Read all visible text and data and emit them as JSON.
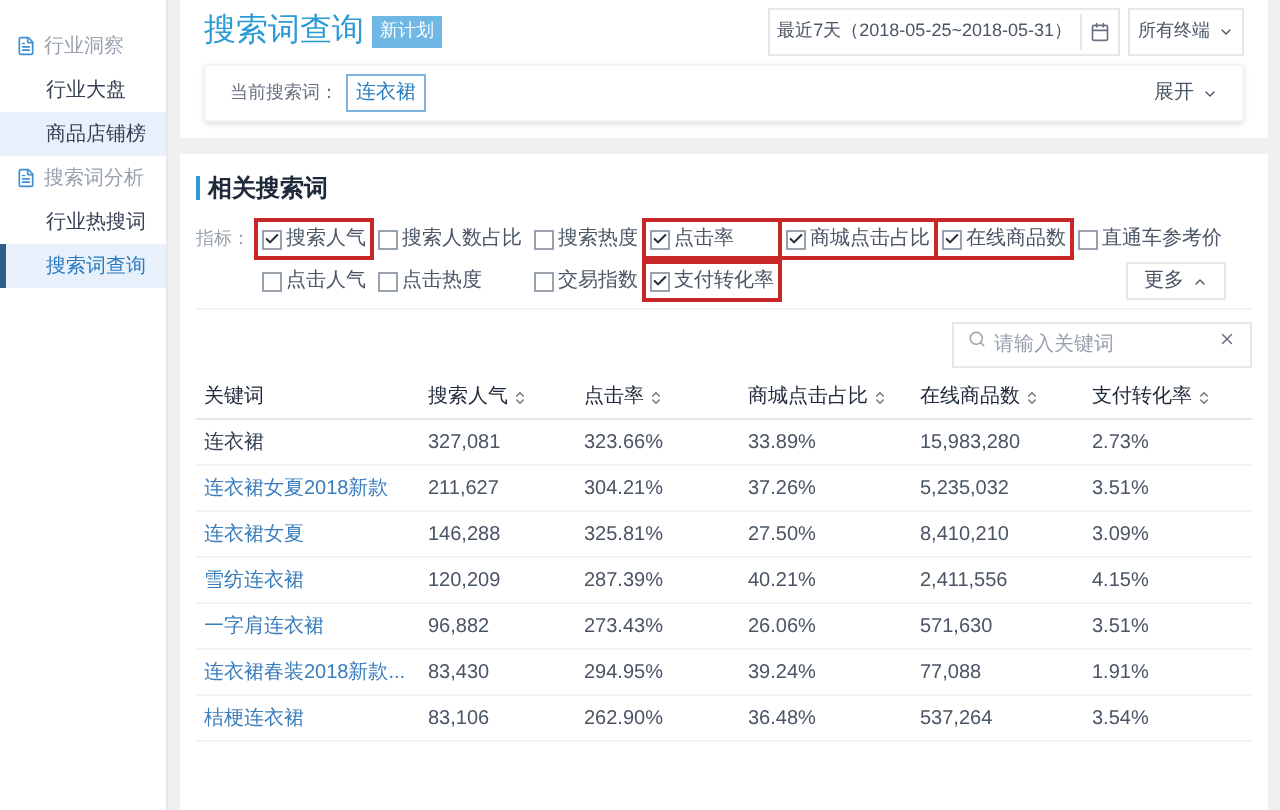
{
  "sidebar": {
    "sections": [
      {
        "title": "行业洞察",
        "children": [
          {
            "label": "行业大盘",
            "selected": false,
            "highlighted": false
          },
          {
            "label": "商品店铺榜",
            "selected": false,
            "highlighted": true
          }
        ]
      },
      {
        "title": "搜索词分析",
        "children": [
          {
            "label": "行业热搜词",
            "selected": false,
            "highlighted": false
          },
          {
            "label": "搜索词查询",
            "selected": true,
            "highlighted": true
          }
        ]
      }
    ]
  },
  "header": {
    "title": "搜索词查询",
    "badge": "新计划",
    "date_range": "最近7天（2018-05-25~2018-05-31）",
    "terminal": "所有终端",
    "current_label": "当前搜索词：",
    "current_word": "连衣裙",
    "expand": "展开"
  },
  "related": {
    "title": "相关搜索词",
    "metrics_label": "指标：",
    "more": "更多",
    "metric_rows": [
      {
        "metrics": [
          {
            "label": "搜索人气",
            "checked": true
          },
          {
            "label": "搜索人数占比",
            "checked": false
          },
          {
            "label": "搜索热度",
            "checked": false
          },
          {
            "label": "点击率",
            "checked": true
          },
          {
            "label": "商城点击占比",
            "checked": true
          },
          {
            "label": "在线商品数",
            "checked": true
          },
          {
            "label": "直通车参考价",
            "checked": false
          }
        ]
      },
      {
        "metrics": [
          {
            "label": "点击人气",
            "checked": false
          },
          {
            "label": "点击热度",
            "checked": false
          },
          {
            "label": "交易指数",
            "checked": false
          },
          {
            "label": "支付转化率",
            "checked": true
          }
        ]
      }
    ],
    "search": {
      "placeholder": "请输入关键词"
    },
    "table": {
      "columns": [
        {
          "label": "关键词",
          "sortable": false
        },
        {
          "label": "搜索人气",
          "sortable": true
        },
        {
          "label": "点击率",
          "sortable": true
        },
        {
          "label": "商城点击占比",
          "sortable": true
        },
        {
          "label": "在线商品数",
          "sortable": true
        },
        {
          "label": "支付转化率",
          "sortable": true
        }
      ],
      "rows": [
        {
          "kind": "text",
          "cells": [
            "连衣裙",
            "327,081",
            "323.66%",
            "33.89%",
            "15,983,280",
            "2.73%"
          ]
        },
        {
          "kind": "link",
          "cells": [
            "连衣裙女夏2018新款",
            "211,627",
            "304.21%",
            "37.26%",
            "5,235,032",
            "3.51%"
          ]
        },
        {
          "kind": "link",
          "cells": [
            "连衣裙女夏",
            "146,288",
            "325.81%",
            "27.50%",
            "8,410,210",
            "3.09%"
          ]
        },
        {
          "kind": "link",
          "cells": [
            "雪纺连衣裙",
            "120,209",
            "287.39%",
            "40.21%",
            "2,411,556",
            "4.15%"
          ]
        },
        {
          "kind": "link",
          "cells": [
            "一字肩连衣裙",
            "96,882",
            "273.43%",
            "26.06%",
            "571,630",
            "3.51%"
          ]
        },
        {
          "kind": "link",
          "cells": [
            "连衣裙春装2018新款...",
            "83,430",
            "294.95%",
            "39.24%",
            "77,088",
            "1.91%"
          ]
        },
        {
          "kind": "link",
          "cells": [
            "桔梗连衣裙",
            "83,106",
            "262.90%",
            "36.48%",
            "537,264",
            "3.54%"
          ]
        }
      ]
    }
  }
}
